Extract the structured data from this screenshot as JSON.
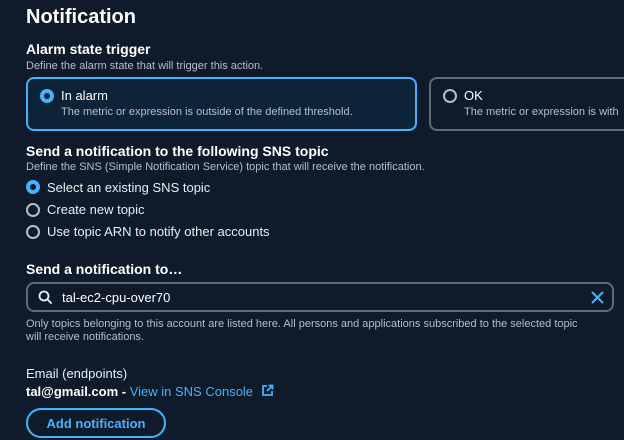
{
  "header": {
    "title": "Notification"
  },
  "alarm_state": {
    "title": "Alarm state trigger",
    "description": "Define the alarm state that will trigger this action.",
    "options": [
      {
        "label": "In alarm",
        "description": "The metric or expression is outside of the defined threshold.",
        "selected": true
      },
      {
        "label": "OK",
        "description": "The metric or expression is with",
        "selected": false
      }
    ]
  },
  "sns_topic": {
    "title": "Send a notification to the following SNS topic",
    "description": "Define the SNS (Simple Notification Service) topic that will receive the notification.",
    "options": [
      {
        "label": "Select an existing SNS topic",
        "selected": true
      },
      {
        "label": "Create new topic",
        "selected": false
      },
      {
        "label": "Use topic ARN to notify other accounts",
        "selected": false
      }
    ]
  },
  "send_to": {
    "title": "Send a notification to…",
    "search_value": "tal-ec2-cpu-over70",
    "help_line1": "Only topics belonging to this account are listed here. All persons and applications subscribed to the selected topic",
    "help_line2": "will receive notifications."
  },
  "endpoints": {
    "title": "Email (endpoints)",
    "email": "tal@gmail.com",
    "separator": " - ",
    "link_text": "View in SNS Console"
  },
  "actions": {
    "add_notification": "Add notification"
  },
  "colors": {
    "accent": "#42b4ff",
    "background": "#0f1b2a",
    "muted": "#b6bec9",
    "border": "#5f6b7a"
  }
}
